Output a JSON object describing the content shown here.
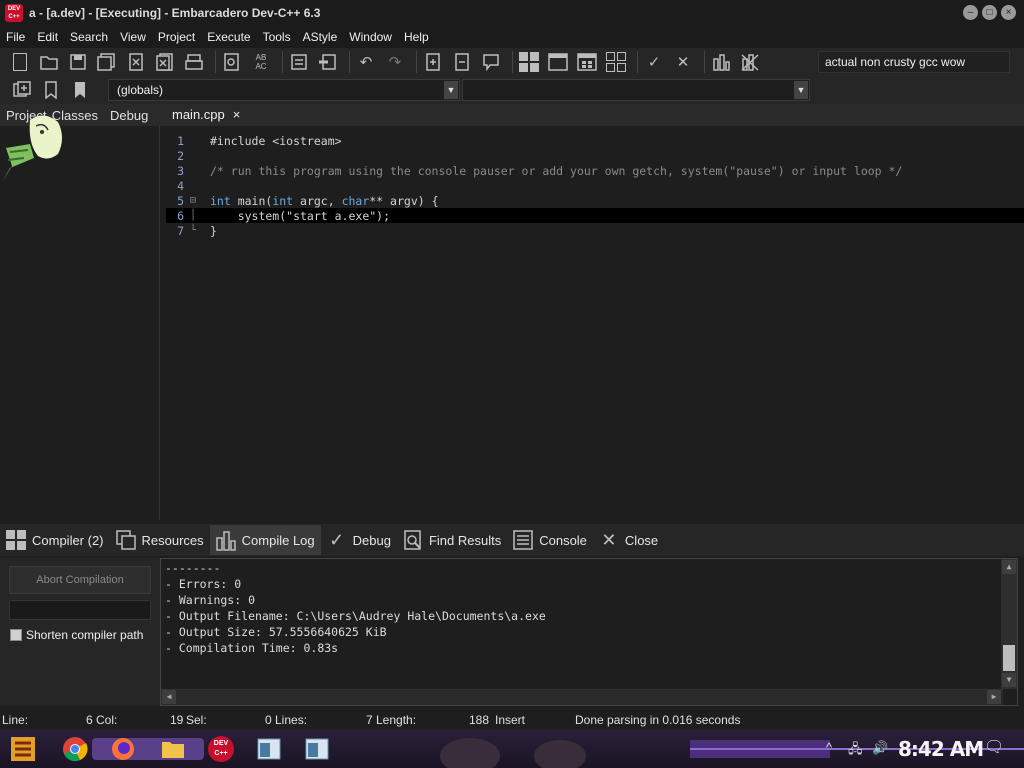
{
  "window": {
    "title": "a - [a.dev] - [Executing] - Embarcadero Dev-C++ 6.3",
    "icon_text": "DEV C++",
    "btn_min": "–",
    "btn_max": "□",
    "btn_close": "×"
  },
  "menu": [
    "File",
    "Edit",
    "Search",
    "View",
    "Project",
    "Execute",
    "Tools",
    "AStyle",
    "Window",
    "Help"
  ],
  "toolbar": {
    "compiler_set": "actual non crusty gcc wow",
    "globals": "(globals)",
    "members": ""
  },
  "left_panel": {
    "tabs": [
      "Project",
      "Classes",
      "Debug"
    ]
  },
  "editor": {
    "tab_label": "main.cpp",
    "tab_close": "×",
    "lines": [
      {
        "n": "1",
        "text": "#include <iostream>"
      },
      {
        "n": "2",
        "text": ""
      },
      {
        "n": "3",
        "text": "/* run this program using the console pauser or add your own getch, system(\"pause\") or input loop */"
      },
      {
        "n": "4",
        "text": ""
      },
      {
        "n": "5",
        "kw1": "int",
        "mid1": " main(",
        "kw2": "int",
        "mid2": " argc, ",
        "kw3": "char",
        "mid3": "** argv) {"
      },
      {
        "n": "6",
        "text": "    system(\"start a.exe\");"
      },
      {
        "n": "7",
        "text": "}"
      }
    ]
  },
  "bottom_tabs": [
    {
      "label": "Compiler (2)",
      "icon": "grid-icon"
    },
    {
      "label": "Resources",
      "icon": "resources-icon"
    },
    {
      "label": "Compile Log",
      "icon": "chart-icon"
    },
    {
      "label": "Debug",
      "icon": "check-icon"
    },
    {
      "label": "Find Results",
      "icon": "find-icon"
    },
    {
      "label": "Console",
      "icon": "console-icon"
    },
    {
      "label": "Close",
      "icon": "close-icon"
    }
  ],
  "compile_panel": {
    "abort_label": "Abort Compilation",
    "shorten_label": "Shorten compiler path"
  },
  "compile_log": [
    "--------",
    "- Errors: 0",
    "- Warnings: 0",
    "- Output Filename: C:\\Users\\Audrey Hale\\Documents\\a.exe",
    "- Output Size: 57.5556640625 KiB",
    "- Compilation Time: 0.83s"
  ],
  "status": {
    "line_label": "Line:",
    "line_val": "6",
    "col_label": "Col:",
    "col_val": "19",
    "sel_label": "Sel:",
    "sel_val": "0",
    "lines_label": "Lines:",
    "lines_val": "7",
    "length_label": "Length:",
    "length_val": "188",
    "mode": "Insert",
    "message": "Done parsing in 0.016 seconds"
  },
  "taskbar": {
    "clock": "8:42 AM",
    "dev_icon_text": "DEV C++"
  }
}
